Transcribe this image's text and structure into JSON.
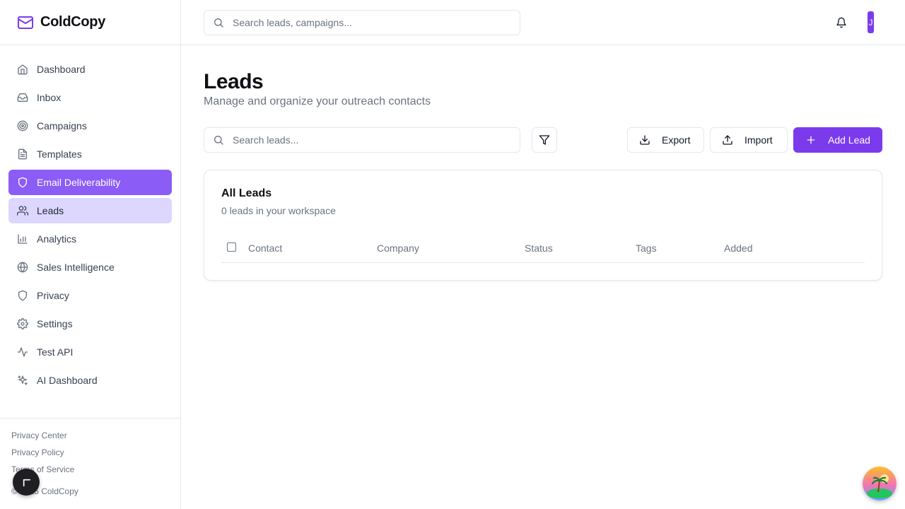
{
  "brand": {
    "name": "ColdCopy"
  },
  "sidebar": {
    "items": [
      {
        "label": "Dashboard",
        "icon": "home-icon"
      },
      {
        "label": "Inbox",
        "icon": "inbox-icon"
      },
      {
        "label": "Campaigns",
        "icon": "target-icon"
      },
      {
        "label": "Templates",
        "icon": "file-text-icon"
      },
      {
        "label": "Email Deliverability",
        "icon": "shield-icon"
      },
      {
        "label": "Leads",
        "icon": "users-icon"
      },
      {
        "label": "Analytics",
        "icon": "bar-chart-icon"
      },
      {
        "label": "Sales Intelligence",
        "icon": "globe-icon"
      },
      {
        "label": "Privacy",
        "icon": "shield-icon"
      },
      {
        "label": "Settings",
        "icon": "gear-icon"
      },
      {
        "label": "Test API",
        "icon": "activity-icon"
      },
      {
        "label": "AI Dashboard",
        "icon": "sparkles-icon"
      }
    ],
    "footer": {
      "links": [
        "Privacy Center",
        "Privacy Policy",
        "Terms of Service"
      ],
      "copyright": "© 2025 ColdCopy"
    }
  },
  "header": {
    "search_placeholder": "Search leads, campaigns...",
    "avatar_initial": "J"
  },
  "page": {
    "title": "Leads",
    "subtitle": "Manage and organize your outreach contacts",
    "search_placeholder": "Search leads...",
    "export_label": "Export",
    "import_label": "Import",
    "add_label": "Add Lead"
  },
  "card": {
    "title": "All Leads",
    "subtitle": "0 leads in your workspace",
    "columns": [
      "Contact",
      "Company",
      "Status",
      "Tags",
      "Added"
    ]
  },
  "colors": {
    "accent": "#7c3aed",
    "active_nav": "#8b5cf6",
    "current_nav": "#ddd6fe"
  }
}
